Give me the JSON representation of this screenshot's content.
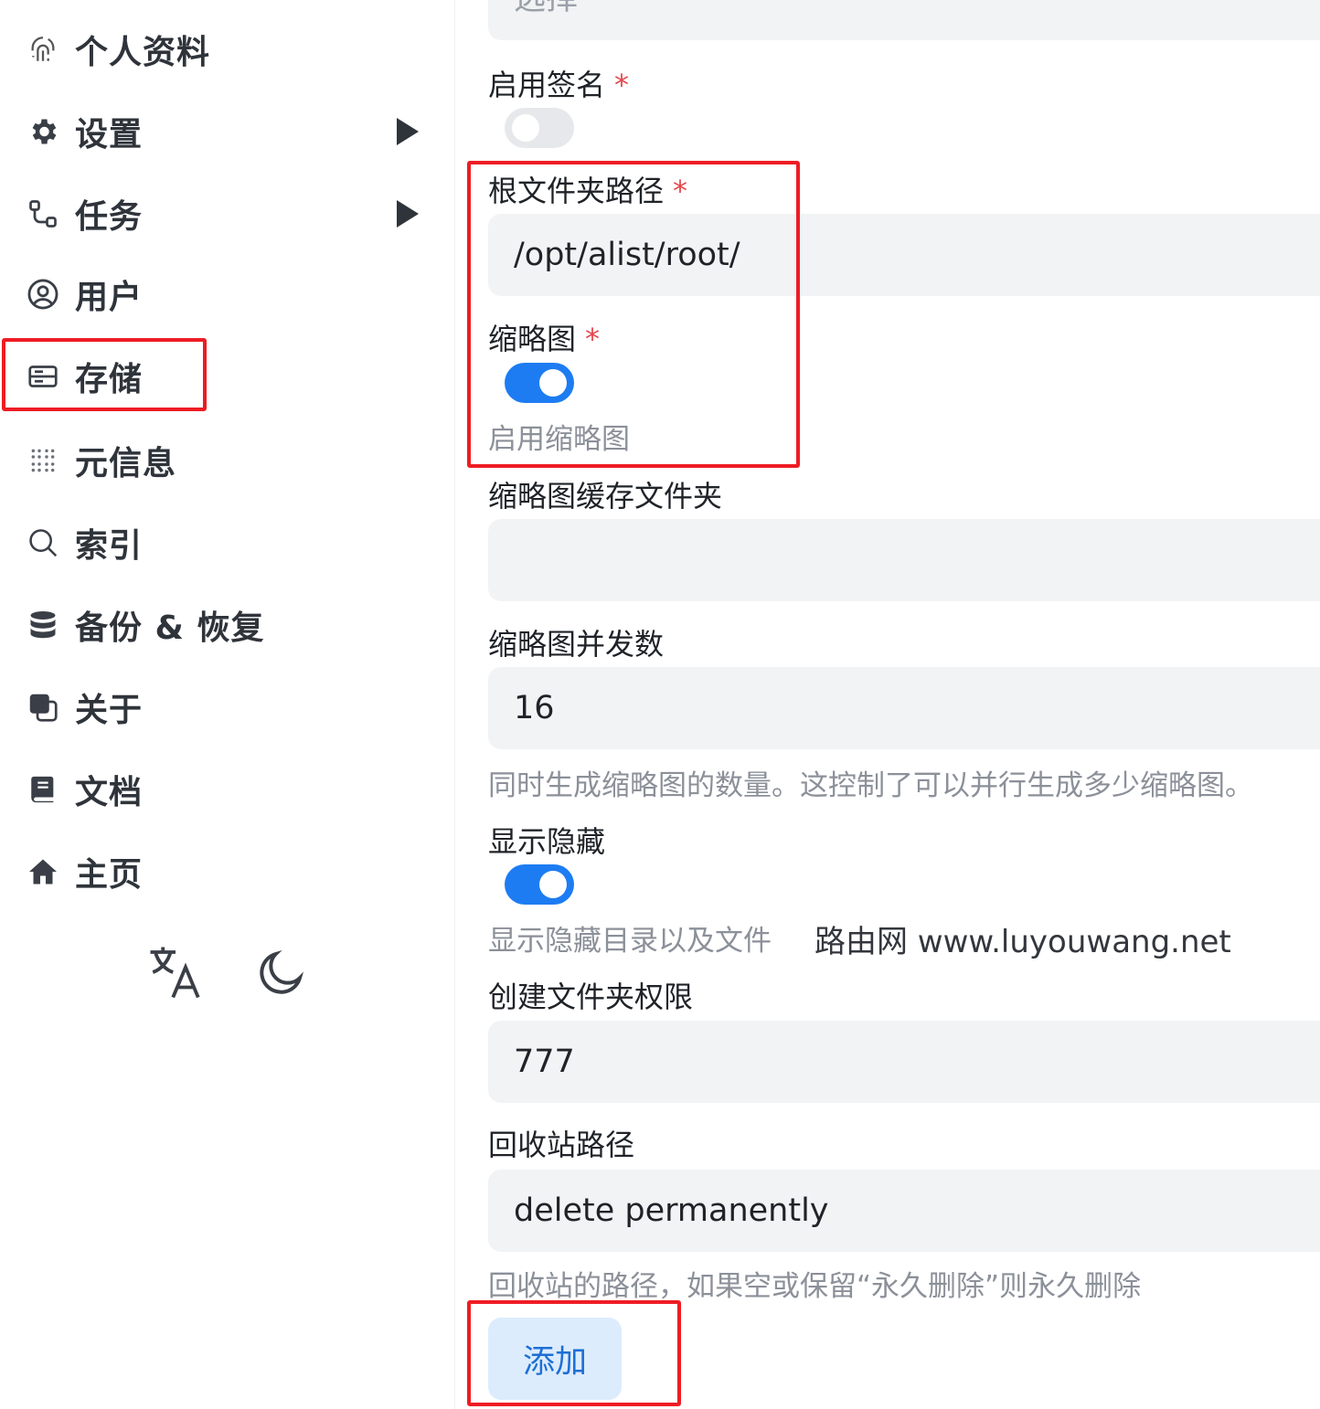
{
  "sidebar": {
    "items": [
      {
        "label": "个人资料",
        "icon": "fingerprint-icon",
        "has_submenu": false
      },
      {
        "label": "设置",
        "icon": "gear-icon",
        "has_submenu": true
      },
      {
        "label": "任务",
        "icon": "workflow-icon",
        "has_submenu": true
      },
      {
        "label": "用户",
        "icon": "user-circle-icon",
        "has_submenu": false
      },
      {
        "label": "存储",
        "icon": "storage-icon",
        "has_submenu": false,
        "active": true
      },
      {
        "label": "元信息",
        "icon": "grid-dots-icon",
        "has_submenu": false
      },
      {
        "label": "索引",
        "icon": "search-icon",
        "has_submenu": false
      },
      {
        "label": "备份 & 恢复",
        "icon": "database-icon",
        "has_submenu": false
      },
      {
        "label": "关于",
        "icon": "copy-icon",
        "has_submenu": false
      },
      {
        "label": "文档",
        "icon": "book-icon",
        "has_submenu": false
      },
      {
        "label": "主页",
        "icon": "home-icon",
        "has_submenu": false
      }
    ],
    "footer": {
      "language_icon": "translate-icon",
      "theme_icon": "moon-icon"
    }
  },
  "form": {
    "top_select_placeholder": "选择",
    "enable_sign": {
      "label": "启用签名",
      "required": "*",
      "value": false
    },
    "root_folder": {
      "label": "根文件夹路径",
      "required": "*",
      "value": "/opt/alist/root/"
    },
    "thumbnail": {
      "label": "缩略图",
      "required": "*",
      "value": true,
      "help": "启用缩略图"
    },
    "thumb_cache": {
      "label": "缩略图缓存文件夹",
      "value": ""
    },
    "thumb_concurrency": {
      "label": "缩略图并发数",
      "value": "16",
      "help": "同时生成缩略图的数量。这控制了可以并行生成多少缩略图。"
    },
    "show_hidden": {
      "label": "显示隐藏",
      "value": true,
      "help": "显示隐藏目录以及文件"
    },
    "mkdir_perm": {
      "label": "创建文件夹权限",
      "value": "777"
    },
    "recycle_bin": {
      "label": "回收站路径",
      "value": "delete permanently",
      "help": "回收站的路径，如果空或保留“永久删除”则永久删除"
    },
    "submit_label": "添加"
  },
  "watermark": "路由网 www.luyouwang.net",
  "colors": {
    "accent": "#1d7cf2",
    "highlight": "#ee1c24",
    "required": "#e5484d",
    "input_bg": "#f1f3f5"
  }
}
